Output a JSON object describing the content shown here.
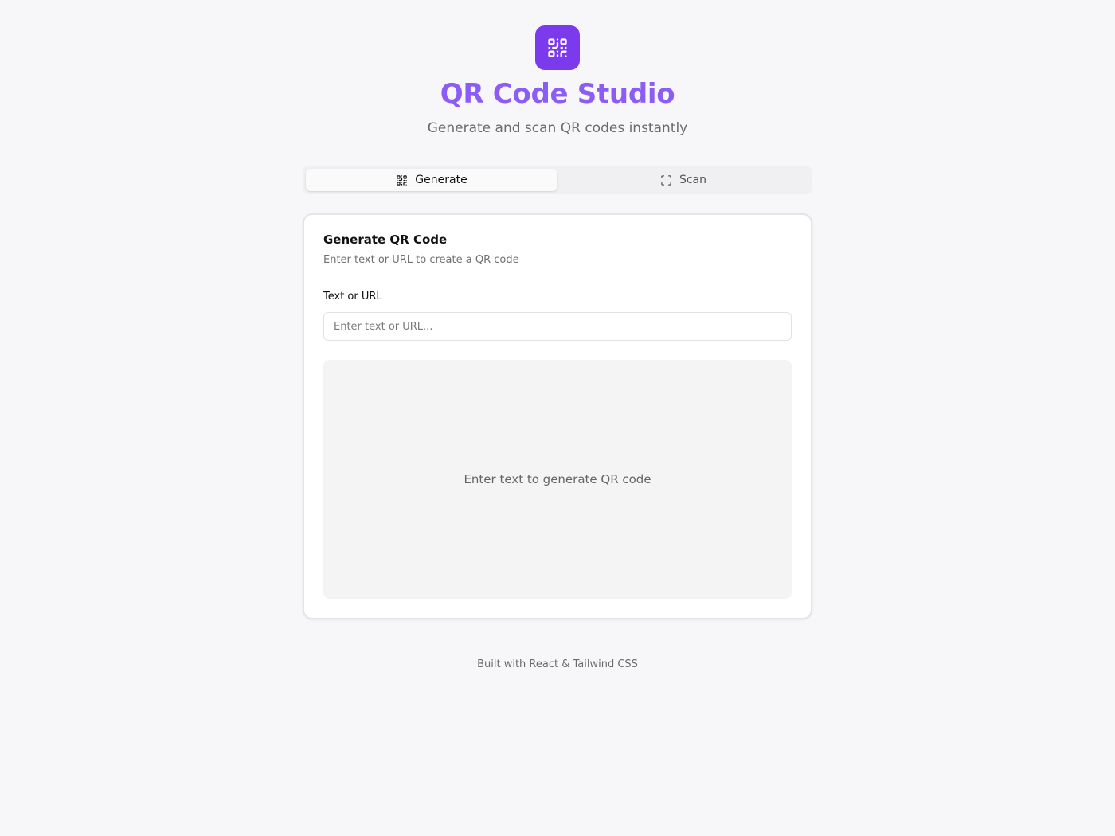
{
  "header": {
    "title": "QR Code Studio",
    "subtitle": "Generate and scan QR codes instantly",
    "logo_icon": "qr-code-icon",
    "accent_color": "#7c3aed"
  },
  "tabs": [
    {
      "label": "Generate",
      "icon": "qr-code-icon",
      "active": true
    },
    {
      "label": "Scan",
      "icon": "scan-frame-icon",
      "active": false
    }
  ],
  "card": {
    "title": "Generate QR Code",
    "description": "Enter text or URL to create a QR code",
    "field_label": "Text or URL",
    "input_placeholder": "Enter text or URL...",
    "input_value": "",
    "preview_placeholder": "Enter text to generate QR code"
  },
  "footer": {
    "text": "Built with React & Tailwind CSS"
  }
}
